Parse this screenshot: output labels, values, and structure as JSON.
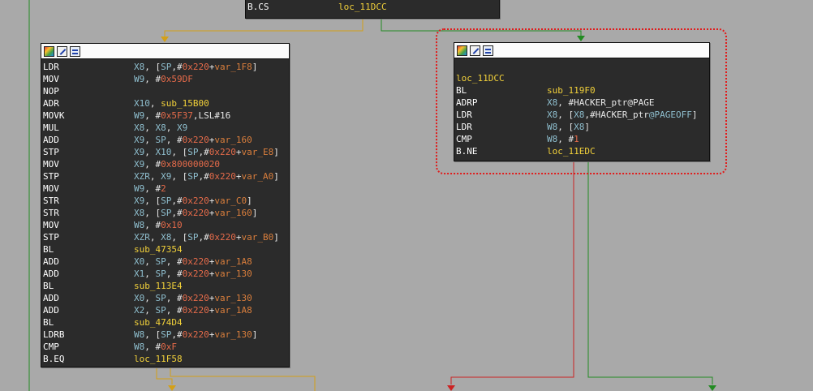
{
  "colors": {
    "background": "#a9a9a9",
    "block_bg": "#2b2b2b",
    "edge_true": "#228b22",
    "edge_false": "#cc2222",
    "edge_uncond": "#d4a017",
    "highlight": "#e11b1b"
  },
  "header_icons": [
    "color-palette-icon",
    "edit-pen-icon",
    "graph-view-icon"
  ],
  "top_block": {
    "lines": [
      {
        "mnemonic": "B.CS",
        "operands": [
          {
            "t": "loc_11DCC",
            "c": "lbl"
          }
        ]
      }
    ]
  },
  "left_block": {
    "lines": [
      {
        "mnemonic": "LDR",
        "operands": [
          {
            "t": "X8",
            "c": "reg"
          },
          {
            "t": ", [",
            "c": "pun"
          },
          {
            "t": "SP",
            "c": "reg"
          },
          {
            "t": ",#",
            "c": "pun"
          },
          {
            "t": "0x220",
            "c": "num"
          },
          {
            "t": "+",
            "c": "pun"
          },
          {
            "t": "var_1F8",
            "c": "var"
          },
          {
            "t": "]",
            "c": "pun"
          }
        ]
      },
      {
        "mnemonic": "MOV",
        "operands": [
          {
            "t": "W9",
            "c": "reg"
          },
          {
            "t": ", #",
            "c": "pun"
          },
          {
            "t": "0x59DF",
            "c": "num"
          }
        ]
      },
      {
        "mnemonic": "NOP",
        "operands": []
      },
      {
        "mnemonic": "ADR",
        "operands": [
          {
            "t": "X10",
            "c": "reg"
          },
          {
            "t": ", ",
            "c": "pun"
          },
          {
            "t": "sub_15B00",
            "c": "sym"
          }
        ]
      },
      {
        "mnemonic": "MOVK",
        "operands": [
          {
            "t": "W9",
            "c": "reg"
          },
          {
            "t": ", #",
            "c": "pun"
          },
          {
            "t": "0x5F37",
            "c": "num"
          },
          {
            "t": ",LSL#16",
            "c": "pun"
          }
        ]
      },
      {
        "mnemonic": "MUL",
        "operands": [
          {
            "t": "X8",
            "c": "reg"
          },
          {
            "t": ", ",
            "c": "pun"
          },
          {
            "t": "X8",
            "c": "reg"
          },
          {
            "t": ", ",
            "c": "pun"
          },
          {
            "t": "X9",
            "c": "reg"
          }
        ]
      },
      {
        "mnemonic": "ADD",
        "operands": [
          {
            "t": "X9",
            "c": "reg"
          },
          {
            "t": ", ",
            "c": "pun"
          },
          {
            "t": "SP",
            "c": "reg"
          },
          {
            "t": ", #",
            "c": "pun"
          },
          {
            "t": "0x220",
            "c": "num"
          },
          {
            "t": "+",
            "c": "pun"
          },
          {
            "t": "var_160",
            "c": "var"
          }
        ]
      },
      {
        "mnemonic": "STP",
        "operands": [
          {
            "t": "X9",
            "c": "reg"
          },
          {
            "t": ", ",
            "c": "pun"
          },
          {
            "t": "X10",
            "c": "reg"
          },
          {
            "t": ", [",
            "c": "pun"
          },
          {
            "t": "SP",
            "c": "reg"
          },
          {
            "t": ",#",
            "c": "pun"
          },
          {
            "t": "0x220",
            "c": "num"
          },
          {
            "t": "+",
            "c": "pun"
          },
          {
            "t": "var_E8",
            "c": "var"
          },
          {
            "t": "]",
            "c": "pun"
          }
        ]
      },
      {
        "mnemonic": "MOV",
        "operands": [
          {
            "t": "X9",
            "c": "reg"
          },
          {
            "t": ", #",
            "c": "pun"
          },
          {
            "t": "0x800000020",
            "c": "num"
          }
        ]
      },
      {
        "mnemonic": "STP",
        "operands": [
          {
            "t": "XZR",
            "c": "reg"
          },
          {
            "t": ", ",
            "c": "pun"
          },
          {
            "t": "X9",
            "c": "reg"
          },
          {
            "t": ", [",
            "c": "pun"
          },
          {
            "t": "SP",
            "c": "reg"
          },
          {
            "t": ",#",
            "c": "pun"
          },
          {
            "t": "0x220",
            "c": "num"
          },
          {
            "t": "+",
            "c": "pun"
          },
          {
            "t": "var_A0",
            "c": "var"
          },
          {
            "t": "]",
            "c": "pun"
          }
        ]
      },
      {
        "mnemonic": "MOV",
        "operands": [
          {
            "t": "W9",
            "c": "reg"
          },
          {
            "t": ", #",
            "c": "pun"
          },
          {
            "t": "2",
            "c": "num"
          }
        ]
      },
      {
        "mnemonic": "STR",
        "operands": [
          {
            "t": "X9",
            "c": "reg"
          },
          {
            "t": ", [",
            "c": "pun"
          },
          {
            "t": "SP",
            "c": "reg"
          },
          {
            "t": ",#",
            "c": "pun"
          },
          {
            "t": "0x220",
            "c": "num"
          },
          {
            "t": "+",
            "c": "pun"
          },
          {
            "t": "var_C0",
            "c": "var"
          },
          {
            "t": "]",
            "c": "pun"
          }
        ]
      },
      {
        "mnemonic": "STR",
        "operands": [
          {
            "t": "X8",
            "c": "reg"
          },
          {
            "t": ", [",
            "c": "pun"
          },
          {
            "t": "SP",
            "c": "reg"
          },
          {
            "t": ",#",
            "c": "pun"
          },
          {
            "t": "0x220",
            "c": "num"
          },
          {
            "t": "+",
            "c": "pun"
          },
          {
            "t": "var_160",
            "c": "var"
          },
          {
            "t": "]",
            "c": "pun"
          }
        ]
      },
      {
        "mnemonic": "MOV",
        "operands": [
          {
            "t": "W8",
            "c": "reg"
          },
          {
            "t": ", #",
            "c": "pun"
          },
          {
            "t": "0x10",
            "c": "num"
          }
        ]
      },
      {
        "mnemonic": "STP",
        "operands": [
          {
            "t": "XZR",
            "c": "reg"
          },
          {
            "t": ", ",
            "c": "pun"
          },
          {
            "t": "X8",
            "c": "reg"
          },
          {
            "t": ", [",
            "c": "pun"
          },
          {
            "t": "SP",
            "c": "reg"
          },
          {
            "t": ",#",
            "c": "pun"
          },
          {
            "t": "0x220",
            "c": "num"
          },
          {
            "t": "+",
            "c": "pun"
          },
          {
            "t": "var_B0",
            "c": "var"
          },
          {
            "t": "]",
            "c": "pun"
          }
        ]
      },
      {
        "mnemonic": "BL",
        "operands": [
          {
            "t": "sub_47354",
            "c": "sym"
          }
        ]
      },
      {
        "mnemonic": "ADD",
        "operands": [
          {
            "t": "X0",
            "c": "reg"
          },
          {
            "t": ", ",
            "c": "pun"
          },
          {
            "t": "SP",
            "c": "reg"
          },
          {
            "t": ", #",
            "c": "pun"
          },
          {
            "t": "0x220",
            "c": "num"
          },
          {
            "t": "+",
            "c": "pun"
          },
          {
            "t": "var_1A8",
            "c": "var"
          }
        ]
      },
      {
        "mnemonic": "ADD",
        "operands": [
          {
            "t": "X1",
            "c": "reg"
          },
          {
            "t": ", ",
            "c": "pun"
          },
          {
            "t": "SP",
            "c": "reg"
          },
          {
            "t": ", #",
            "c": "pun"
          },
          {
            "t": "0x220",
            "c": "num"
          },
          {
            "t": "+",
            "c": "pun"
          },
          {
            "t": "var_130",
            "c": "var"
          }
        ]
      },
      {
        "mnemonic": "BL",
        "operands": [
          {
            "t": "sub_113E4",
            "c": "sym"
          }
        ]
      },
      {
        "mnemonic": "ADD",
        "operands": [
          {
            "t": "X0",
            "c": "reg"
          },
          {
            "t": ", ",
            "c": "pun"
          },
          {
            "t": "SP",
            "c": "reg"
          },
          {
            "t": ", #",
            "c": "pun"
          },
          {
            "t": "0x220",
            "c": "num"
          },
          {
            "t": "+",
            "c": "pun"
          },
          {
            "t": "var_130",
            "c": "var"
          }
        ]
      },
      {
        "mnemonic": "ADD",
        "operands": [
          {
            "t": "X2",
            "c": "reg"
          },
          {
            "t": ", ",
            "c": "pun"
          },
          {
            "t": "SP",
            "c": "reg"
          },
          {
            "t": ", #",
            "c": "pun"
          },
          {
            "t": "0x220",
            "c": "num"
          },
          {
            "t": "+",
            "c": "pun"
          },
          {
            "t": "var_1A8",
            "c": "var"
          }
        ]
      },
      {
        "mnemonic": "BL",
        "operands": [
          {
            "t": "sub_474D4",
            "c": "sym"
          }
        ]
      },
      {
        "mnemonic": "LDRB",
        "operands": [
          {
            "t": "W8",
            "c": "reg"
          },
          {
            "t": ", [",
            "c": "pun"
          },
          {
            "t": "SP",
            "c": "reg"
          },
          {
            "t": ",#",
            "c": "pun"
          },
          {
            "t": "0x220",
            "c": "num"
          },
          {
            "t": "+",
            "c": "pun"
          },
          {
            "t": "var_130",
            "c": "var"
          },
          {
            "t": "]",
            "c": "pun"
          }
        ]
      },
      {
        "mnemonic": "CMP",
        "operands": [
          {
            "t": "W8",
            "c": "reg"
          },
          {
            "t": ", #",
            "c": "pun"
          },
          {
            "t": "0xF",
            "c": "num"
          }
        ]
      },
      {
        "mnemonic": "B.EQ",
        "operands": [
          {
            "t": "loc_11F58",
            "c": "sym"
          }
        ]
      }
    ]
  },
  "right_block": {
    "lines": [
      {
        "mnemonic": "",
        "operands": []
      },
      {
        "mnemonic": "loc_11DCC",
        "label": true,
        "operands": []
      },
      {
        "mnemonic": "BL",
        "operands": [
          {
            "t": "sub_119F0",
            "c": "sym"
          }
        ]
      },
      {
        "mnemonic": "ADRP",
        "operands": [
          {
            "t": "X8",
            "c": "reg"
          },
          {
            "t": ", #HACKER_ptr@PAGE",
            "c": "pun"
          }
        ]
      },
      {
        "mnemonic": "LDR",
        "operands": [
          {
            "t": "X8",
            "c": "reg"
          },
          {
            "t": ", [",
            "c": "pun"
          },
          {
            "t": "X8",
            "c": "reg"
          },
          {
            "t": ",#HACKER_ptr",
            "c": "pun"
          },
          {
            "t": "@PAGEOFF",
            "c": "pageoff"
          },
          {
            "t": "]",
            "c": "pun"
          }
        ]
      },
      {
        "mnemonic": "LDR",
        "operands": [
          {
            "t": "W8",
            "c": "reg"
          },
          {
            "t": ", [",
            "c": "pun"
          },
          {
            "t": "X8",
            "c": "reg"
          },
          {
            "t": "]",
            "c": "pun"
          }
        ]
      },
      {
        "mnemonic": "CMP",
        "operands": [
          {
            "t": "W8",
            "c": "reg"
          },
          {
            "t": ", #",
            "c": "pun"
          },
          {
            "t": "1",
            "c": "num"
          }
        ]
      },
      {
        "mnemonic": "B.NE",
        "operands": [
          {
            "t": "loc_11EDC",
            "c": "sym"
          }
        ]
      }
    ]
  }
}
